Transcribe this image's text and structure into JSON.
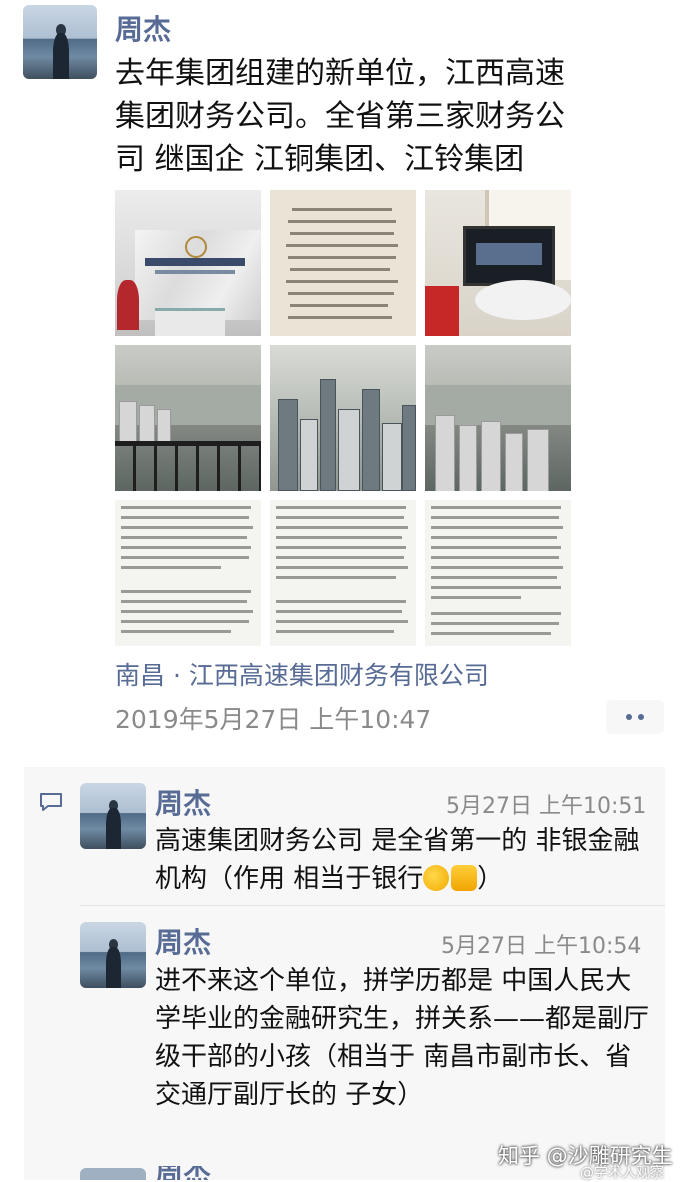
{
  "post": {
    "author": "周杰",
    "text": "去年集团组建的新单位，江西高速集团财务公司。全省第三家财务公司 继国企 江铜集团、江铃集团",
    "location": "南昌 · 江西高速集团财务有限公司",
    "timestamp": "2019年5月27日 上午10:47",
    "more_icon": "ellipsis-icon"
  },
  "comments": [
    {
      "author": "周杰",
      "time": "5月27日 上午10:51",
      "text": "高速集团财务公司 是全省第一的 非银金融机构（作用 相当于银行",
      "text_end": "）",
      "emojis": [
        "thinking-face-icon",
        "thumbs-up-icon"
      ]
    },
    {
      "author": "周杰",
      "time": "5月27日 上午10:54",
      "text": "进不来这个单位，拼学历都是 中国人民大学毕业的金融研究生，拼关系——都是副厅级干部的小孩（相当于 南昌市副市长、省交通厅副厅长的 子女）"
    }
  ],
  "partial_comment": {
    "author": "周杰"
  },
  "watermark": {
    "main": "知乎 @沙雕研究生",
    "sub": "@学术人观察"
  },
  "colors": {
    "name": "#576b95",
    "time": "#8a8a8a",
    "comment_bg": "#f7f7f7"
  }
}
